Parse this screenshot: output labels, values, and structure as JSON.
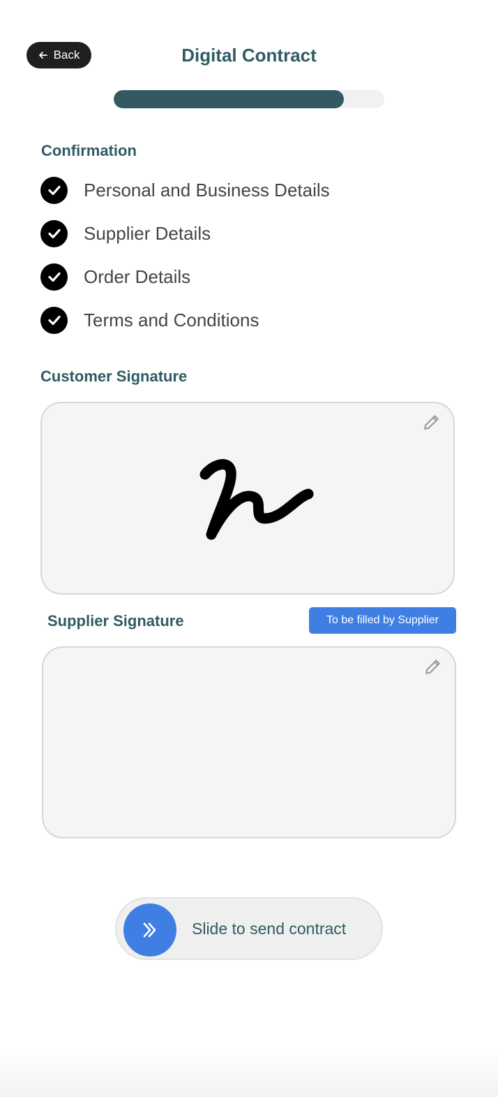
{
  "header": {
    "back_label": "Back",
    "title": "Digital Contract",
    "progress_fraction": 0.85
  },
  "confirmation": {
    "heading": "Confirmation",
    "items": [
      {
        "label": "Personal and Business Details",
        "checked": true
      },
      {
        "label": "Supplier Details",
        "checked": true
      },
      {
        "label": "Order Details",
        "checked": true
      },
      {
        "label": "Terms and Conditions",
        "checked": true
      }
    ]
  },
  "customer_signature": {
    "heading": "Customer Signature",
    "edit_icon": "pencil-icon"
  },
  "supplier_signature": {
    "heading": "Supplier Signature",
    "badge": "To be filled by Supplier",
    "edit_icon": "pencil-icon"
  },
  "slider": {
    "label": "Slide to send contract",
    "thumb_icon": "double-chevron-right-icon"
  },
  "colors": {
    "accent": "#2f5b62",
    "brand_blue": "#3f7fe4",
    "progress_fill": "#335a61"
  }
}
